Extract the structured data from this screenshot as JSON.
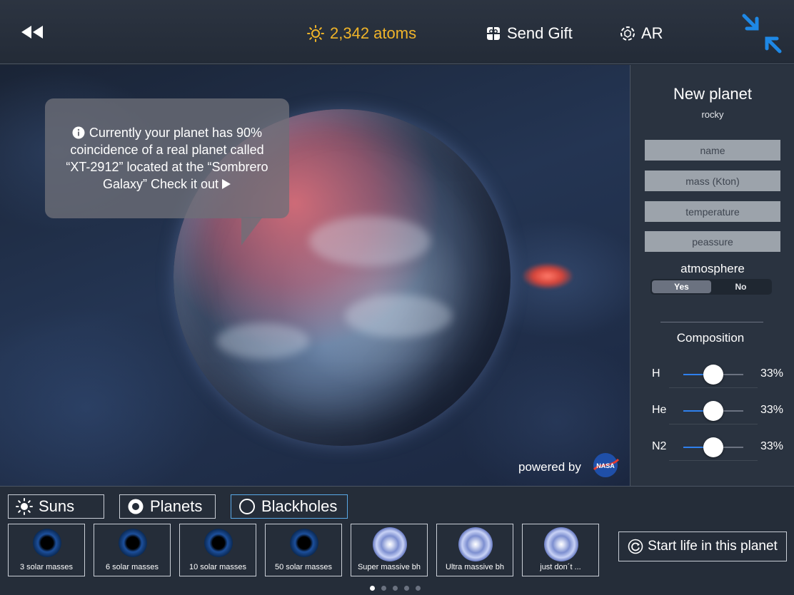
{
  "header": {
    "atoms": "2,342 atoms",
    "send_gift": "Send Gift",
    "ar": "AR",
    "accent_color": "#f0b429",
    "collapse_color": "#1e88e5"
  },
  "info": {
    "message": "Currently your planet has 90% coincidence of a real planet called “XT-2912” located at the “Sombrero Galaxy” Check it out",
    "powered_by": "powered by"
  },
  "panel": {
    "title": "New planet",
    "subtitle": "rocky",
    "fields": {
      "name": "name",
      "mass": "mass (Kton)",
      "temperature": "temperature",
      "pressure": "peassure"
    },
    "atmosphere": {
      "label": "atmosphere",
      "yes": "Yes",
      "no": "No",
      "selected": "Yes"
    },
    "composition": {
      "label": "Composition",
      "items": [
        {
          "element": "H",
          "percent": "33%",
          "level": 0.5
        },
        {
          "element": "He",
          "percent": "33%",
          "level": 0.5
        },
        {
          "element": "N2",
          "percent": "33%",
          "level": 0.5
        }
      ]
    }
  },
  "categories": {
    "tabs": [
      "Suns",
      "Planets",
      "Blackholes"
    ],
    "selected": "Planets",
    "highlighted": "Blackholes"
  },
  "items": [
    {
      "label": "3 solar masses",
      "icon": "blackhole-icon"
    },
    {
      "label": "6 solar masses",
      "icon": "blackhole-icon"
    },
    {
      "label": "10 solar masses",
      "icon": "blackhole-icon"
    },
    {
      "label": "50 solar masses",
      "icon": "blackhole-icon"
    },
    {
      "label": "Super massive bh",
      "icon": "spiral-blackhole-icon"
    },
    {
      "label": "Ultra massive bh",
      "icon": "spiral-blackhole-icon"
    },
    {
      "label": "just don´t ...",
      "icon": "spiral-blackhole-icon"
    }
  ],
  "start_button": "Start life in this planet",
  "pagination": {
    "pages": 5,
    "current": 1
  }
}
